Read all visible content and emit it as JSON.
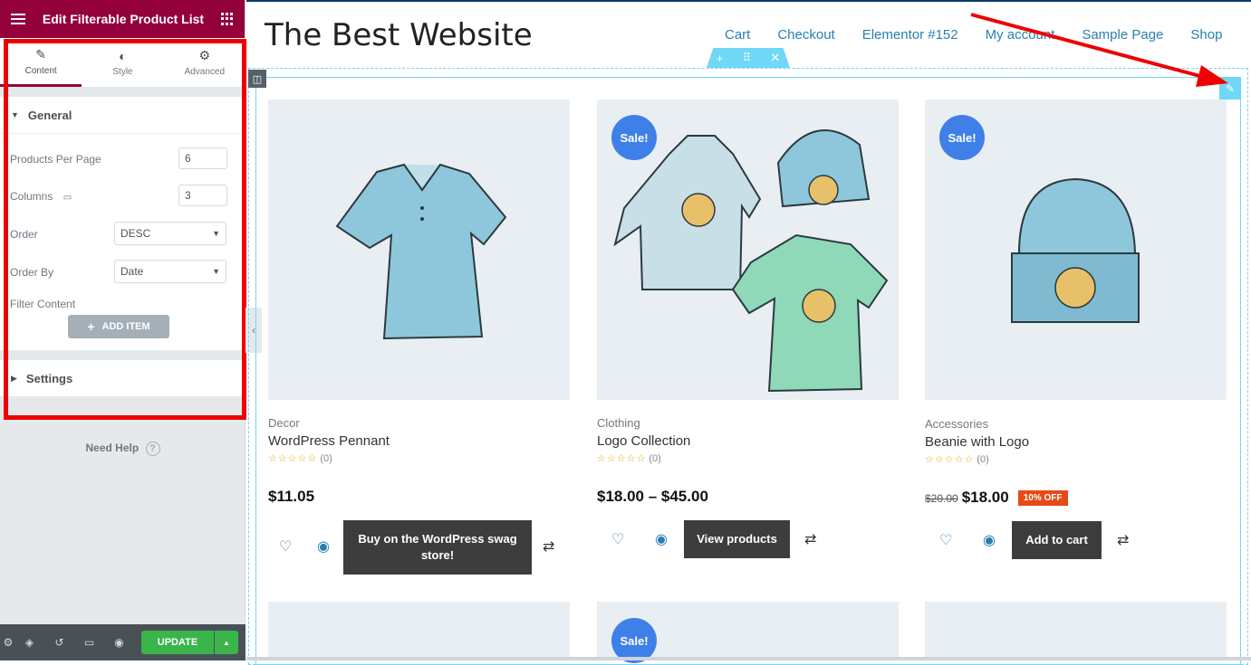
{
  "panel": {
    "title": "Edit Filterable Product List",
    "tabs": [
      {
        "label": "Content",
        "icon": "pencil-icon"
      },
      {
        "label": "Style",
        "icon": "half-circle-icon"
      },
      {
        "label": "Advanced",
        "icon": "gear-icon"
      }
    ],
    "general": {
      "title": "General",
      "products_per_page_label": "Products Per Page",
      "products_per_page_value": "6",
      "columns_label": "Columns",
      "columns_value": "3",
      "order_label": "Order",
      "order_value": "DESC",
      "order_by_label": "Order By",
      "order_by_value": "Date",
      "filter_content_label": "Filter Content",
      "add_item_label": "ADD ITEM"
    },
    "settings_title": "Settings",
    "need_help": "Need Help",
    "update_label": "UPDATE"
  },
  "site": {
    "title": "The Best Website",
    "nav": [
      "Cart",
      "Checkout",
      "Elementor #152",
      "My account",
      "Sample Page",
      "Shop"
    ]
  },
  "products": [
    {
      "category": "Decor",
      "name": "WordPress Pennant",
      "rating_count": "(0)",
      "price": "$11.05",
      "button": "Buy on the WordPress swag store!",
      "sale": false
    },
    {
      "category": "Clothing",
      "name": "Logo Collection",
      "rating_count": "(0)",
      "price": "$18.00 – $45.00",
      "button": "View products",
      "sale": true,
      "sale_label": "Sale!"
    },
    {
      "category": "Accessories",
      "name": "Beanie with Logo",
      "rating_count": "(0)",
      "old_price": "$20.00",
      "price": "$18.00",
      "discount": "10% OFF",
      "button": "Add to cart",
      "sale": true,
      "sale_label": "Sale!"
    }
  ],
  "row2_sale_label": "Sale!",
  "colors": {
    "panel_header": "#93003c",
    "accent_blue": "#71d7f7",
    "update_green": "#39b54a",
    "highlight_red": "#ee0000"
  }
}
